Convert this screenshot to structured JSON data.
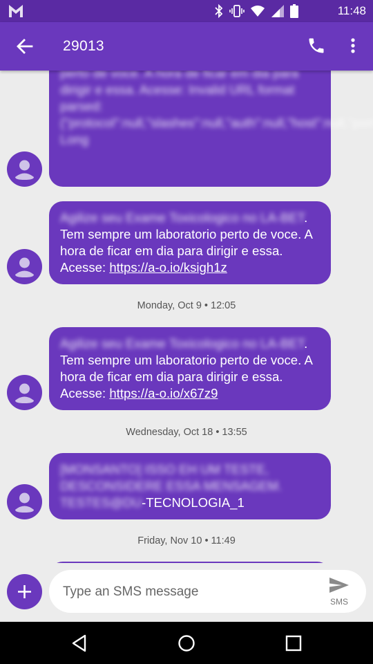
{
  "status_bar": {
    "time": "11:48"
  },
  "app_bar": {
    "title": "29013"
  },
  "messages": [
    {
      "blurred_text": "perto de voce. A hora de ficar em dia para dirigir e essa. Acesse: Invalid URL format parsed: {\"protocol\":null,\"slashes\":null,\"auth\":null,\"host\":null,\"port\":null,\"hostname\":null,\"hash\":null,\"search\":null,\"query\":null,\"pathname\":null,\"path\":null,\"href\":\"\"} Long"
    },
    {
      "blurred_text": "Agilize seu Exame Toxicologico no LA-BET",
      "text": ". Tem sempre um laboratorio perto de voce. A hora de ficar em dia para dirigir e essa. Acesse: ",
      "link": "https://a-o.io/ksigh1z"
    },
    {
      "blurred_text": "Agilize seu Exame Toxicologico no LA-BET",
      "text": ". Tem sempre um laboratorio perto de voce. A hora de ficar em dia para dirigir e essa. Acesse: ",
      "link": "https://a-o.io/x67z9"
    },
    {
      "blurred_text": "[MONSANTO] ISSO EH UM TESTE, DESCONSIDERE ESSA MENSAGEM. TESTES@DU",
      "text": "-TECNOLOGIA_1"
    }
  ],
  "timestamps": [
    "Monday, Oct 9 • 12:05",
    "Wednesday, Oct 18 • 13:55",
    "Friday, Nov 10 • 11:49"
  ],
  "compose": {
    "placeholder": "Type an SMS message",
    "send_label": "SMS"
  },
  "colors": {
    "accent": "#6a38bd",
    "status_bar": "#5a2aa3",
    "background": "#ececec"
  }
}
